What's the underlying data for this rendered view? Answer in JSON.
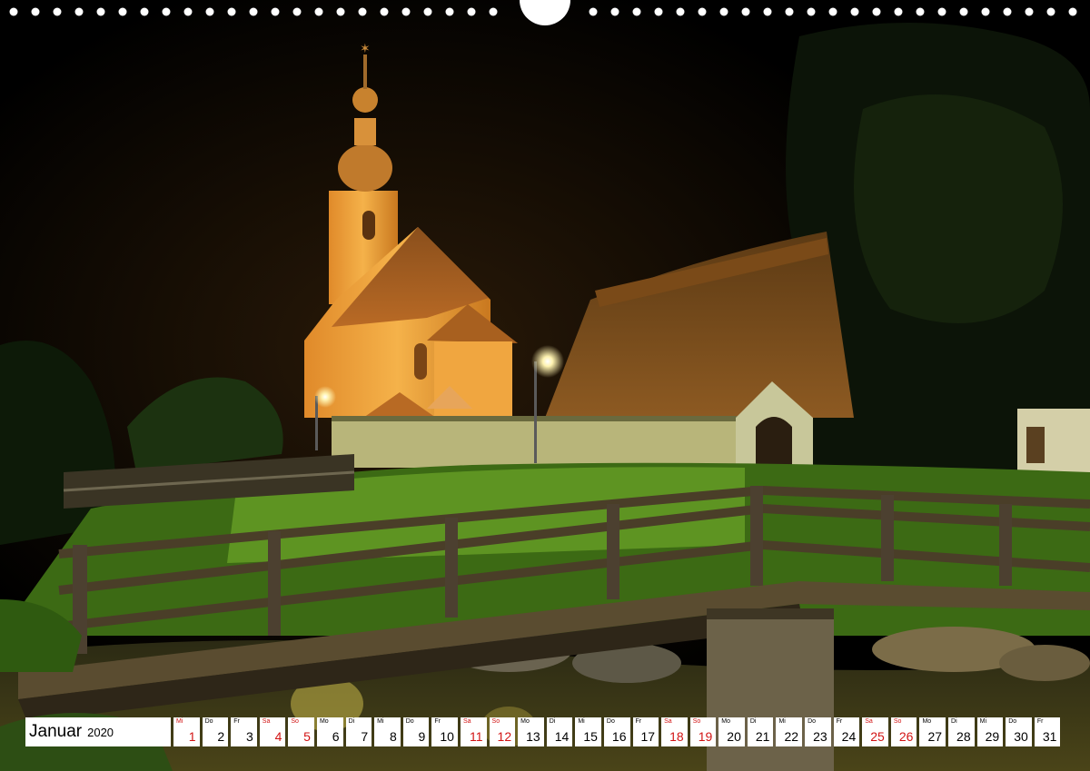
{
  "calendar": {
    "month": "Januar",
    "year": "2020",
    "weekend_color": "#d21414",
    "days": [
      {
        "dow": "Mi",
        "num": "1",
        "weekend": true
      },
      {
        "dow": "Do",
        "num": "2",
        "weekend": false
      },
      {
        "dow": "Fr",
        "num": "3",
        "weekend": false
      },
      {
        "dow": "Sa",
        "num": "4",
        "weekend": true
      },
      {
        "dow": "So",
        "num": "5",
        "weekend": true
      },
      {
        "dow": "Mo",
        "num": "6",
        "weekend": false
      },
      {
        "dow": "Di",
        "num": "7",
        "weekend": false
      },
      {
        "dow": "Mi",
        "num": "8",
        "weekend": false
      },
      {
        "dow": "Do",
        "num": "9",
        "weekend": false
      },
      {
        "dow": "Fr",
        "num": "10",
        "weekend": false
      },
      {
        "dow": "Sa",
        "num": "11",
        "weekend": true
      },
      {
        "dow": "So",
        "num": "12",
        "weekend": true
      },
      {
        "dow": "Mo",
        "num": "13",
        "weekend": false
      },
      {
        "dow": "Di",
        "num": "14",
        "weekend": false
      },
      {
        "dow": "Mi",
        "num": "15",
        "weekend": false
      },
      {
        "dow": "Do",
        "num": "16",
        "weekend": false
      },
      {
        "dow": "Fr",
        "num": "17",
        "weekend": false
      },
      {
        "dow": "Sa",
        "num": "18",
        "weekend": true
      },
      {
        "dow": "So",
        "num": "19",
        "weekend": true
      },
      {
        "dow": "Mo",
        "num": "20",
        "weekend": false
      },
      {
        "dow": "Di",
        "num": "21",
        "weekend": false
      },
      {
        "dow": "Mi",
        "num": "22",
        "weekend": false
      },
      {
        "dow": "Do",
        "num": "23",
        "weekend": false
      },
      {
        "dow": "Fr",
        "num": "24",
        "weekend": false
      },
      {
        "dow": "Sa",
        "num": "25",
        "weekend": true
      },
      {
        "dow": "So",
        "num": "26",
        "weekend": true
      },
      {
        "dow": "Mo",
        "num": "27",
        "weekend": false
      },
      {
        "dow": "Di",
        "num": "28",
        "weekend": false
      },
      {
        "dow": "Mi",
        "num": "29",
        "weekend": false
      },
      {
        "dow": "Do",
        "num": "30",
        "weekend": false
      },
      {
        "dow": "Fr",
        "num": "31",
        "weekend": false
      }
    ]
  },
  "photo": {
    "subject": "illuminated-church-night-photo"
  }
}
